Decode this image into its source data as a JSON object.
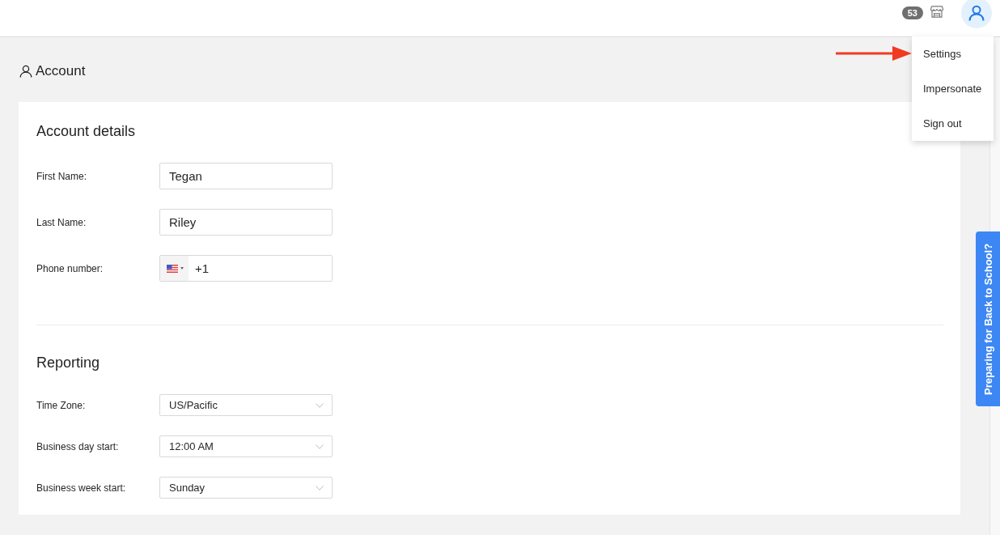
{
  "top_bar": {
    "badge": "53",
    "user_menu": {
      "expanded": true,
      "items": [
        {
          "label": "Settings"
        },
        {
          "label": "Impersonate"
        },
        {
          "label": "Sign out"
        }
      ]
    }
  },
  "page": {
    "title": "Account"
  },
  "sections": [
    {
      "title": "Account details",
      "fields": [
        {
          "kind": "text",
          "label": "First Name:",
          "value": "Tegan"
        },
        {
          "kind": "text",
          "label": "Last Name:",
          "value": "Riley"
        },
        {
          "kind": "phone",
          "label": "Phone number:",
          "value": "+1"
        }
      ]
    },
    {
      "title": "Reporting",
      "fields": [
        {
          "kind": "select",
          "label": "Time Zone:",
          "value": "US/Pacific"
        },
        {
          "kind": "select",
          "label": "Business day start:",
          "value": "12:00 AM"
        },
        {
          "kind": "select",
          "label": "Business week start:",
          "value": "Sunday"
        }
      ]
    }
  ],
  "side_tab": {
    "label": "Preparing for Back to School?"
  }
}
